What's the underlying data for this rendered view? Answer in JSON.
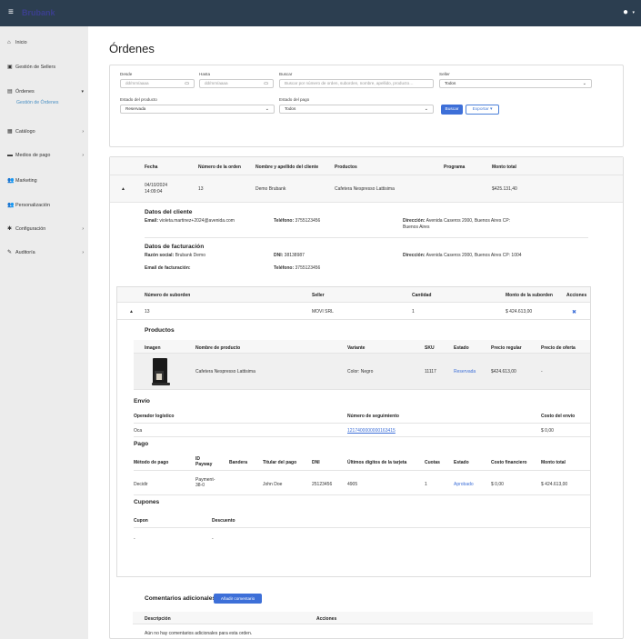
{
  "topbar": {
    "brand": "Brubank",
    "user_caret": "▾"
  },
  "sidebar": {
    "items": [
      {
        "label": "Inicio",
        "icon": "home-icon",
        "glyph": "⌂"
      },
      {
        "label": "Gestión de Sellers",
        "icon": "store-icon",
        "glyph": "▣"
      },
      {
        "label": "Órdenes",
        "icon": "list-icon",
        "glyph": "▤",
        "chevron": "▾"
      },
      {
        "label": "Catálogo",
        "icon": "book-icon",
        "glyph": "▦",
        "chevron": "›"
      },
      {
        "label": "Medios de pago",
        "icon": "card-icon",
        "glyph": "▬",
        "chevron": "›"
      },
      {
        "label": "Marketing",
        "icon": "users-icon",
        "glyph": "👥"
      },
      {
        "label": "Personalización",
        "icon": "users-icon",
        "glyph": "👥"
      },
      {
        "label": "Configuración",
        "icon": "gear-icon",
        "glyph": "✱",
        "chevron": "›"
      },
      {
        "label": "Auditoría",
        "icon": "edit-icon",
        "glyph": "✎",
        "chevron": "›"
      }
    ],
    "sub_item": "Gestión de Órdenes"
  },
  "page": {
    "title": "Órdenes"
  },
  "filters": {
    "desde_label": "Desde",
    "desde_placeholder": "dd/mm/aaaa",
    "hasta_label": "Hasta",
    "hasta_placeholder": "dd/mm/aaaa",
    "buscar_label": "Buscar",
    "buscar_placeholder": "Buscar por número de orden, suborden, nombre, apellido, producto…",
    "seller_label": "Seller",
    "seller_value": "Todos",
    "estado_producto_label": "Estado del producto",
    "estado_producto_value": "Reservada",
    "estado_pago_label": "Estado del pago",
    "estado_pago_value": "Todos",
    "search_button": "Buscar",
    "export_button": "Exportar ▾"
  },
  "orders": {
    "headers": [
      "Fecha",
      "Número de la orden",
      "Nombre y apellido del cliente",
      "Productos",
      "Programa",
      "Monto total"
    ],
    "row": {
      "toggle": "▲",
      "fecha_date": "04/10/2024",
      "fecha_time": "14:09:04",
      "numero": "13",
      "cliente": "Demo Brubank",
      "productos": "Cafetera Nespresso Lattisima",
      "programa": "",
      "monto": "$425.131,40"
    }
  },
  "client": {
    "title": "Datos del cliente",
    "email_label": "Email:",
    "email": "violeta.martinez+2024@avenida.com",
    "tel_label": "Teléfono:",
    "tel": "3755123456",
    "dir_label": "Dirección:",
    "dir": "Avenida Caseros 2000, Buenos Aires CP: Buenos Aires"
  },
  "billing": {
    "title": "Datos de facturación",
    "razon_label": "Razón social:",
    "razon": "Brubank Demo",
    "dni_label": "DNI:",
    "dni": "38138987",
    "dir_label": "Dirección:",
    "dir": "Avenida Caseros 2000, Buenos Aires CP: 1004",
    "email_label": "Email de facturación:",
    "email": "",
    "tel_label": "Teléfono:",
    "tel": "3755123456"
  },
  "suborders": {
    "headers": [
      "Número de suborden",
      "Seller",
      "Cantidad",
      "Monto de la suborden",
      "Acciones"
    ],
    "row": {
      "toggle": "▲",
      "numero": "13",
      "seller": "MOVI SRL",
      "cantidad": "1",
      "monto": "$ 424.613,00",
      "action": "✖"
    }
  },
  "products": {
    "title": "Productos",
    "headers": [
      "Imagen",
      "Nombre de producto",
      "Variante",
      "SKU",
      "Estado",
      "Precio regular",
      "Precio de oferta"
    ],
    "row": {
      "nombre": "Cafetera Nespresso Lattisima",
      "variante": "Color: Negro",
      "sku": "11117",
      "estado": "Reservada",
      "precio": "$424.613,00",
      "oferta": "-"
    }
  },
  "shipping": {
    "title": "Envío",
    "headers": [
      "Operador logístico",
      "Número de seguimiento",
      "Costo del envío"
    ],
    "row": {
      "operador": "Oca",
      "tracking": "1217400000000163415",
      "costo": "$ 0,00"
    }
  },
  "payment": {
    "title": "Pago",
    "headers": [
      "Método de pago",
      "ID Payway",
      "Bandera",
      "Titular del pago",
      "DNI",
      "Últimos dígitos de la tarjeta",
      "Cuotas",
      "Estado",
      "Costo financiero",
      "Monto total"
    ],
    "row": {
      "metodo": "Decidir",
      "id": "Payment-38-0",
      "bandera": "",
      "titular": "John Doe",
      "dni": "25123456",
      "digitos": "4905",
      "cuotas": "1",
      "estado": "Aprobado",
      "costo": "$ 0,00",
      "monto": "$ 424.613,00"
    }
  },
  "coupons": {
    "title": "Cupones",
    "headers": [
      "Cupon",
      "Descuento"
    ],
    "row": {
      "cupon": "-",
      "descuento": "-"
    }
  },
  "comments": {
    "title": "Comentarios adicionales",
    "add_button": "Añadir comentario",
    "headers": [
      "Descripción",
      "Acciones"
    ],
    "empty": "Aún no hay comentarios adicionales para esta orden."
  },
  "colors": {
    "topbar": "#2c3e50",
    "sidebar": "#ececec",
    "accent": "#3d6fd8"
  }
}
